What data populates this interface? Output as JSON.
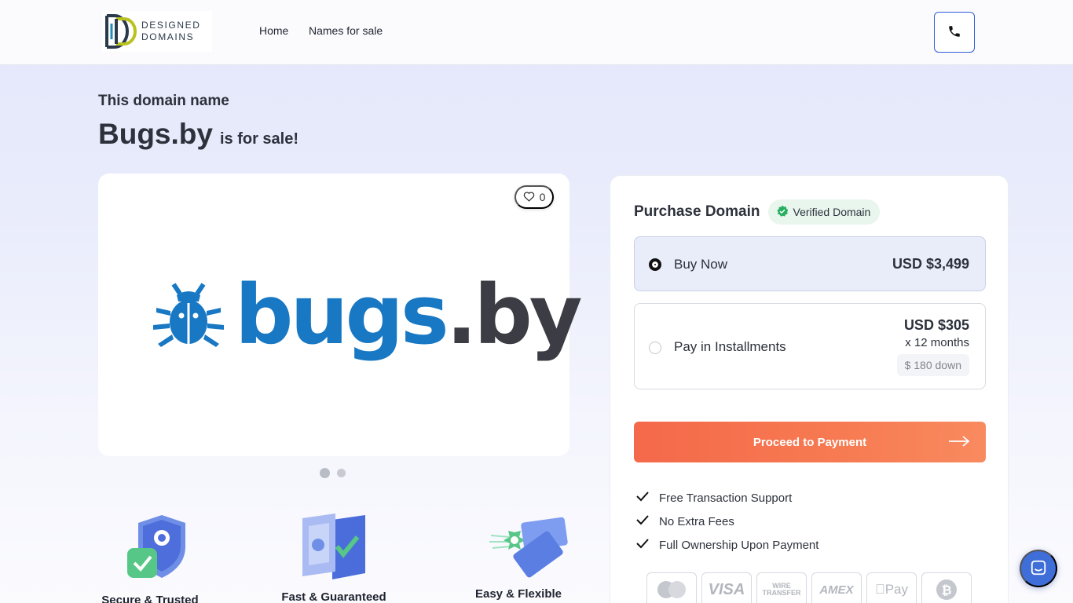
{
  "header": {
    "logo_text_line1": "DESIGNED",
    "logo_text_line2": "DOMAINS",
    "nav": [
      {
        "label": "Home"
      },
      {
        "label": "Names for sale"
      }
    ]
  },
  "hero": {
    "eyebrow": "This domain name",
    "domain": "Bugs.by",
    "suffix": "is for sale!"
  },
  "image_card": {
    "likes": "0",
    "brand_main": "bugs",
    "brand_dot": ".by",
    "carousel_active_index": 0,
    "carousel_count": 2
  },
  "features": [
    {
      "label": "Secure & Trusted"
    },
    {
      "label": "Fast & Guaranteed"
    },
    {
      "label": "Easy & Flexible"
    }
  ],
  "purchase": {
    "title": "Purchase Domain",
    "verified_label": "Verified Domain",
    "options": [
      {
        "label": "Buy Now",
        "price": "USD $3,499",
        "selected": true
      },
      {
        "label": "Pay in Installments",
        "price": "USD $305",
        "months": "x 12 months",
        "down": "$ 180 down",
        "selected": false
      }
    ],
    "cta": "Proceed to Payment",
    "benefits": [
      "Free Transaction Support",
      "No Extra Fees",
      "Full Ownership Upon Payment"
    ],
    "payment_methods": [
      "mastercard",
      "VISA",
      "WIRE TRANSFER",
      "AMEX",
      "Pay",
      "bitcoin"
    ]
  },
  "colors": {
    "accent_blue": "#2d5bd7",
    "cta_orange": "#f4694a",
    "brand_blue": "#1978c3",
    "verified_green": "#27ae60"
  }
}
